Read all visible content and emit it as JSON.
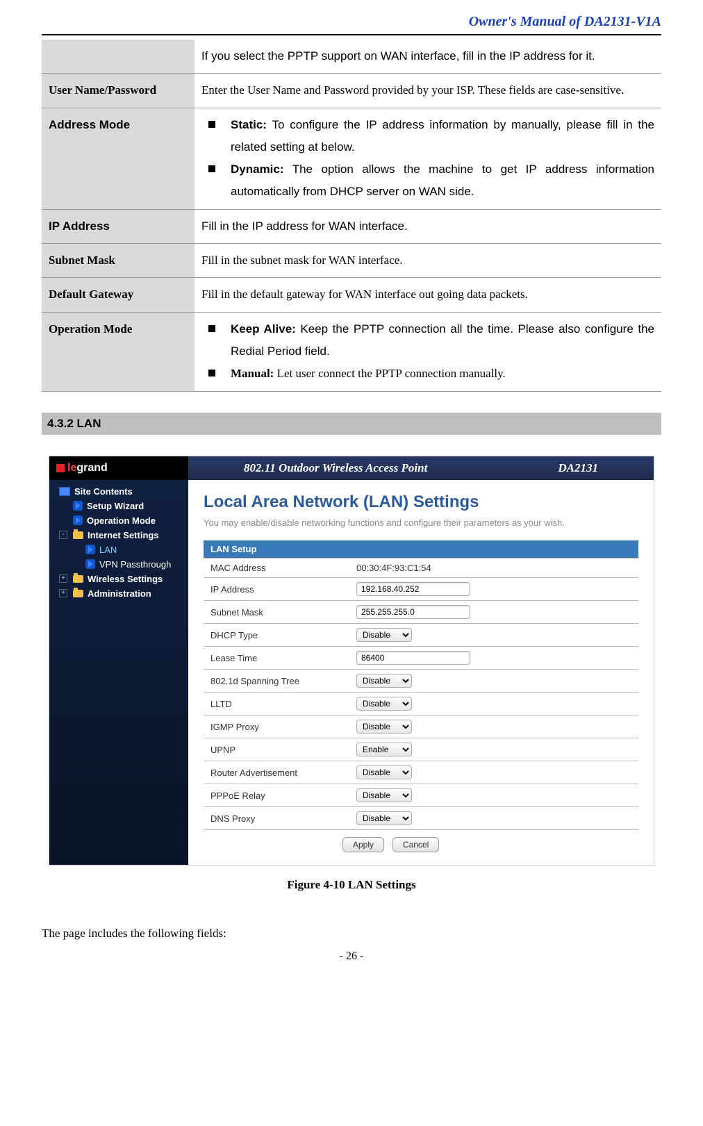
{
  "header": {
    "title": "Owner's Manual of DA2131-V1A"
  },
  "table": {
    "rows": [
      {
        "label": "",
        "label_arial": false,
        "value_arial": true,
        "plain": "If you select the PPTP support on WAN interface, fill in the IP address for it."
      },
      {
        "label": "User Name/Password",
        "label_arial": false,
        "value_arial": false,
        "plain": "Enter the User Name and Password provided by your ISP. These fields are case-sensitive."
      },
      {
        "label": "Address Mode",
        "label_arial": true,
        "value_arial": true,
        "bullets": [
          {
            "bold": "Static:",
            "rest": " To configure the IP address information by manually, please fill in the related setting at below."
          },
          {
            "bold": "Dynamic:",
            "rest": " The option allows the machine to get IP address information automatically from DHCP server on WAN side."
          }
        ]
      },
      {
        "label": "IP Address",
        "label_arial": true,
        "value_arial": true,
        "plain": "Fill in the IP address for WAN interface."
      },
      {
        "label": "Subnet Mask",
        "label_arial": false,
        "value_arial": false,
        "plain": "Fill in the subnet mask for WAN interface."
      },
      {
        "label": "Default Gateway",
        "label_arial": false,
        "value_arial": false,
        "plain": "Fill in the default gateway for WAN interface out going data packets."
      },
      {
        "label": "Operation Mode",
        "label_arial": false,
        "value_arial": true,
        "bullets": [
          {
            "bold": "Keep Alive:",
            "rest": " Keep the PPTP connection all the time. Please also configure the Redial Period field.",
            "arial": true
          },
          {
            "bold": "Manual:",
            "rest": " Let user connect the PPTP connection manually.",
            "arial": false
          }
        ]
      }
    ]
  },
  "section": {
    "heading": "4.3.2  LAN"
  },
  "screenshot": {
    "brand_prefix": "le",
    "brand_suffix": "grand",
    "banner_left": "802.11 Outdoor Wireless Access Point",
    "banner_right": "DA2131",
    "side": {
      "root": "Site Contents",
      "items": [
        {
          "label": "Setup Wizard",
          "type": "arrow"
        },
        {
          "label": "Operation Mode",
          "type": "arrow"
        },
        {
          "label": "Internet Settings",
          "type": "folder",
          "sign": "-",
          "children": [
            {
              "label": "LAN",
              "active": true
            },
            {
              "label": "VPN Passthrough",
              "active": false
            }
          ]
        },
        {
          "label": "Wireless Settings",
          "type": "folder",
          "sign": "+"
        },
        {
          "label": "Administration",
          "type": "folder",
          "sign": "+"
        }
      ]
    },
    "main": {
      "title": "Local Area Network (LAN) Settings",
      "desc": "You may enable/disable networking functions and configure their parameters as your wish.",
      "setup_header": "LAN Setup",
      "rows": [
        {
          "label": "MAC Address",
          "type": "text",
          "value": "00:30:4F:93:C1:54"
        },
        {
          "label": "IP Address",
          "type": "input",
          "value": "192.168.40.252"
        },
        {
          "label": "Subnet Mask",
          "type": "input",
          "value": "255.255.255.0"
        },
        {
          "label": "DHCP Type",
          "type": "select",
          "value": "Disable"
        },
        {
          "label": "Lease Time",
          "type": "input",
          "value": "86400"
        },
        {
          "label": "802.1d Spanning Tree",
          "type": "select",
          "value": "Disable"
        },
        {
          "label": "LLTD",
          "type": "select",
          "value": "Disable"
        },
        {
          "label": "IGMP Proxy",
          "type": "select",
          "value": "Disable"
        },
        {
          "label": "UPNP",
          "type": "select",
          "value": "Enable"
        },
        {
          "label": "Router Advertisement",
          "type": "select",
          "value": "Disable"
        },
        {
          "label": "PPPoE Relay",
          "type": "select",
          "value": "Disable"
        },
        {
          "label": "DNS Proxy",
          "type": "select",
          "value": "Disable"
        }
      ],
      "apply": "Apply",
      "cancel": "Cancel"
    }
  },
  "figure_caption": "Figure 4-10 LAN Settings",
  "closing_text": "The page includes the following fields:",
  "page_number": "- 26 -"
}
